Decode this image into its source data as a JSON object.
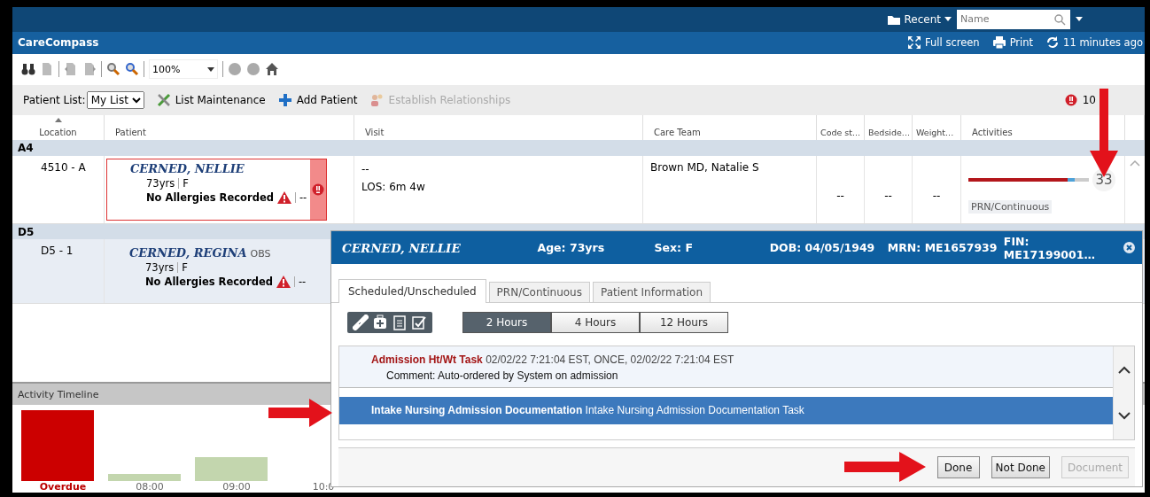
{
  "top_bar": {
    "recent": "Recent",
    "search": {
      "placeholder": "Name"
    }
  },
  "title_bar": {
    "title": "CareCompass",
    "actions": [
      {
        "kind": "fullscreen",
        "label": "Full screen"
      },
      {
        "kind": "print",
        "label": "Print"
      },
      {
        "kind": "refresh",
        "label": "11 minutes ago"
      }
    ]
  },
  "toolbar": {
    "zoom": "100%"
  },
  "patient_list_bar": {
    "label": "Patient List:",
    "list": "My List",
    "actions": [
      {
        "kind": "tools",
        "label": "List Maintenance",
        "disabled": false
      },
      {
        "kind": "add",
        "label": "Add Patient",
        "disabled": false
      },
      {
        "kind": "people",
        "label": "Establish Relationships",
        "disabled": true
      }
    ],
    "alert_count": "10"
  },
  "table": {
    "columns": [
      {
        "label": "Location",
        "sorted": true
      },
      {
        "label": "Patient",
        "sorted": false
      },
      {
        "label": "Visit",
        "sorted": false
      },
      {
        "label": "Care Team",
        "sorted": false
      },
      {
        "label": "Code st...",
        "sorted": false
      },
      {
        "label": "Bedside...",
        "sorted": false
      },
      {
        "label": "Weight...",
        "sorted": false
      },
      {
        "label": "Activities",
        "sorted": false
      }
    ],
    "groups": [
      {
        "name": "A4",
        "rows": [
          {
            "selected": false,
            "location": "4510 - A",
            "patient": {
              "name": "CERNED, NELLIE",
              "age": "73yrs",
              "sex": "F",
              "allergies": "No Allergies Recorded",
              "extra": "--",
              "flagged": true
            },
            "visit": [
              "--",
              "LOS: 6m 4w"
            ],
            "care_team": "Brown MD, Natalie S",
            "code_status": "--",
            "bedside": "--",
            "weight": "--",
            "activities": {
              "level": 0.82,
              "count": "33",
              "label": "PRN/Continuous"
            }
          }
        ]
      },
      {
        "name": "D5",
        "rows": [
          {
            "selected": true,
            "location": "D5 - 1",
            "patient": {
              "name": "CERNED, REGINA",
              "name_tag": "OBS",
              "age": "73yrs",
              "sex": "F",
              "allergies": "No Allergies Recorded",
              "extra": "--",
              "flagged": false
            }
          }
        ]
      }
    ]
  },
  "activity_timeline": {
    "title": "Activity Timeline",
    "labels": [
      {
        "text": "Overdue",
        "kind": "overdue"
      },
      {
        "text": "08:00",
        "kind": "time"
      },
      {
        "text": "09:00",
        "kind": "time"
      },
      {
        "text": "10:0",
        "kind": "time"
      }
    ]
  },
  "popup": {
    "patient": "CERNED, NELLIE",
    "fields": [
      "Age: 73yrs",
      "Sex: F",
      "DOB: 04/05/1949",
      "MRN: ME1657939",
      "FIN: ME17199001…"
    ],
    "tabs": [
      {
        "label": "Scheduled/Unscheduled",
        "selected": true
      },
      {
        "label": "PRN/Continuous",
        "selected": false
      },
      {
        "label": "Patient Information",
        "selected": false
      }
    ],
    "ranges": [
      {
        "label": "2 Hours",
        "selected": true
      },
      {
        "label": "4 Hours",
        "selected": false
      },
      {
        "label": "12 Hours",
        "selected": false
      }
    ],
    "tasks": [
      {
        "title": "Admission Ht/Wt Task",
        "details": "02/02/22 7:21:04 EST, ONCE, 02/02/22 7:21:04 EST",
        "comment": "Comment: Auto-ordered by System on admission",
        "selected": false
      },
      {
        "title": "Intake Nursing Admission Documentation",
        "details": "Intake Nursing Admission Documentation Task",
        "selected": true
      }
    ],
    "buttons": [
      {
        "label": "Done",
        "disabled": false
      },
      {
        "label": "Not Done",
        "disabled": false
      },
      {
        "label": "Document",
        "disabled": true
      }
    ]
  }
}
